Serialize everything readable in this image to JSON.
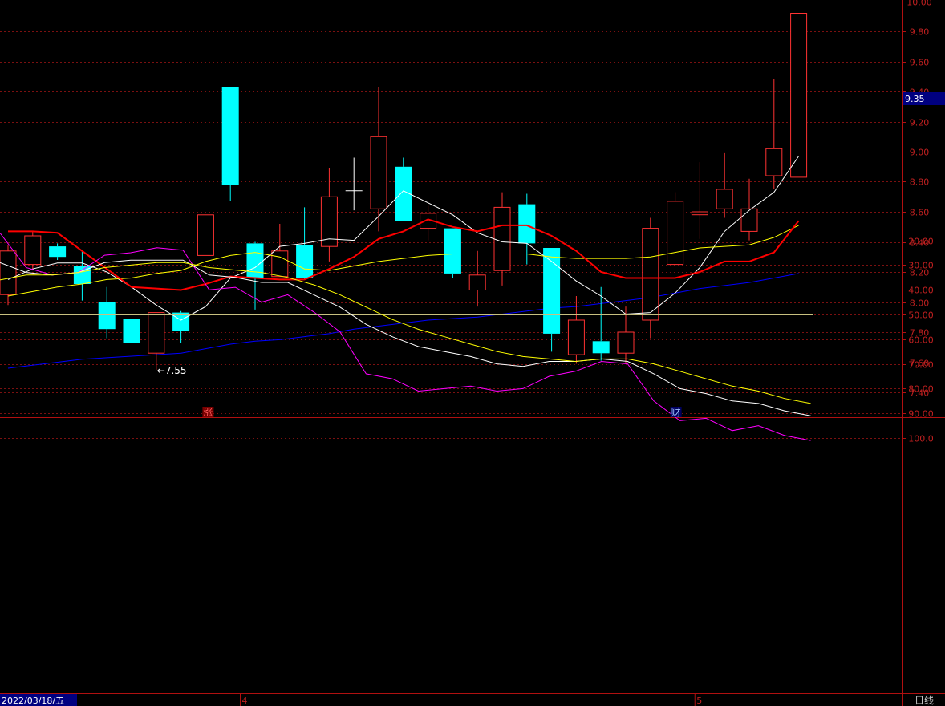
{
  "chart_data": {
    "type": "candlestick",
    "price_axis": {
      "ticks": [
        "10.00",
        "9.80",
        "9.60",
        "9.40",
        "9.20",
        "9.00",
        "8.80",
        "8.60",
        "8.40",
        "8.20",
        "8.00",
        "7.80",
        "7.60",
        "7.40"
      ],
      "ylim": [
        7.23,
        10.03
      ],
      "current_price_label": "9.35"
    },
    "candles": [
      {
        "o": 8.05,
        "h": 8.38,
        "l": 7.98,
        "c": 8.34
      },
      {
        "o": 8.25,
        "h": 8.47,
        "l": 8.21,
        "c": 8.44
      },
      {
        "o": 8.37,
        "h": 8.39,
        "l": 8.28,
        "c": 8.3
      },
      {
        "o": 8.24,
        "h": 8.34,
        "l": 8.01,
        "c": 8.12
      },
      {
        "o": 8.0,
        "h": 8.1,
        "l": 7.76,
        "c": 7.82
      },
      {
        "o": 7.89,
        "h": 7.89,
        "l": 7.73,
        "c": 7.73
      },
      {
        "o": 7.66,
        "h": 7.93,
        "l": 7.55,
        "c": 7.93
      },
      {
        "o": 7.93,
        "h": 7.94,
        "l": 7.73,
        "c": 7.81
      },
      {
        "o": 8.31,
        "h": 8.58,
        "l": 8.31,
        "c": 8.58
      },
      {
        "o": 9.43,
        "h": 9.43,
        "l": 8.67,
        "c": 8.78
      },
      {
        "o": 8.39,
        "h": 8.4,
        "l": 7.95,
        "c": 8.16
      },
      {
        "o": 8.17,
        "h": 8.52,
        "l": 8.17,
        "c": 8.34
      },
      {
        "o": 8.38,
        "h": 8.63,
        "l": 8.15,
        "c": 8.16
      },
      {
        "o": 8.37,
        "h": 8.89,
        "l": 8.27,
        "c": 8.7
      },
      {
        "o": 8.74,
        "h": 8.96,
        "l": 8.61,
        "c": 8.74
      },
      {
        "o": 8.62,
        "h": 9.43,
        "l": 8.47,
        "c": 9.1
      },
      {
        "o": 8.9,
        "h": 8.96,
        "l": 8.54,
        "c": 8.54
      },
      {
        "o": 8.49,
        "h": 8.64,
        "l": 8.41,
        "c": 8.59
      },
      {
        "o": 8.49,
        "h": 8.49,
        "l": 8.16,
        "c": 8.19
      },
      {
        "o": 8.08,
        "h": 8.34,
        "l": 7.97,
        "c": 8.18
      },
      {
        "o": 8.21,
        "h": 8.73,
        "l": 8.11,
        "c": 8.63
      },
      {
        "o": 8.65,
        "h": 8.72,
        "l": 8.25,
        "c": 8.39
      },
      {
        "o": 8.36,
        "h": 8.36,
        "l": 7.67,
        "c": 7.79
      },
      {
        "o": 7.65,
        "h": 8.04,
        "l": 7.59,
        "c": 7.88
      },
      {
        "o": 7.74,
        "h": 8.1,
        "l": 7.61,
        "c": 7.66
      },
      {
        "o": 7.66,
        "h": 7.97,
        "l": 7.59,
        "c": 7.8
      },
      {
        "o": 7.88,
        "h": 8.56,
        "l": 7.76,
        "c": 8.49
      },
      {
        "o": 8.25,
        "h": 8.73,
        "l": 8.25,
        "c": 8.67
      },
      {
        "o": 8.58,
        "h": 8.93,
        "l": 8.42,
        "c": 8.6
      },
      {
        "o": 8.62,
        "h": 8.99,
        "l": 8.56,
        "c": 8.75
      },
      {
        "o": 8.47,
        "h": 8.82,
        "l": 8.41,
        "c": 8.62
      },
      {
        "o": 8.84,
        "h": 9.48,
        "l": 8.75,
        "c": 9.02
      },
      {
        "o": 8.83,
        "h": 9.92,
        "l": 8.83,
        "c": 9.92
      }
    ],
    "ma_lines": [
      {
        "color": "#ffffff",
        "values": [
          8.15,
          8.22,
          8.26,
          8.26,
          8.2,
          8.1,
          7.98,
          7.88,
          7.97,
          8.16,
          8.23,
          8.37,
          8.39,
          8.42,
          8.41,
          8.57,
          8.74,
          8.66,
          8.58,
          8.46,
          8.4,
          8.39,
          8.27,
          8.14,
          8.04,
          7.92,
          7.93,
          8.06,
          8.23,
          8.47,
          8.61,
          8.73,
          8.97
        ]
      },
      {
        "color": "#ffff00",
        "values": [
          8.04,
          8.07,
          8.1,
          8.12,
          8.15,
          8.16,
          8.19,
          8.21,
          8.27,
          8.31,
          8.33,
          8.3,
          8.22,
          8.21,
          8.24,
          8.27,
          8.29,
          8.31,
          8.32,
          8.32,
          8.32,
          8.32,
          8.3,
          8.29,
          8.29,
          8.29,
          8.3,
          8.33,
          8.36,
          8.37,
          8.38,
          8.43,
          8.51
        ]
      },
      {
        "color": "#ff0000",
        "values": [
          8.47,
          8.47,
          8.46,
          8.34,
          8.22,
          8.1,
          8.09,
          8.08,
          8.12,
          8.17,
          8.16,
          8.15,
          8.15,
          8.22,
          8.3,
          8.42,
          8.47,
          8.55,
          8.5,
          8.47,
          8.51,
          8.51,
          8.44,
          8.34,
          8.2,
          8.16,
          8.16,
          8.16,
          8.2,
          8.27,
          8.27,
          8.33,
          8.54
        ]
      },
      {
        "color": "#0000ff",
        "values": [
          7.56,
          7.58,
          7.6,
          7.62,
          7.63,
          7.64,
          7.65,
          7.66,
          7.69,
          7.72,
          7.74,
          7.75,
          7.77,
          7.79,
          7.82,
          7.84,
          7.86,
          7.88,
          7.89,
          7.9,
          7.92,
          7.94,
          7.96,
          7.97,
          7.99,
          8.01,
          8.03,
          8.06,
          8.09,
          8.11,
          8.13,
          8.16,
          8.19
        ]
      }
    ],
    "annotations": [
      {
        "text": "←7.55",
        "index": 6
      },
      {
        "text": "涨",
        "index": 8
      },
      {
        "text": "财",
        "index": 27
      }
    ],
    "indicator": {
      "ticks": [
        "100.0",
        "90.00",
        "80.00",
        "70.00",
        "60.00",
        "50.00",
        "40.00",
        "30.00",
        "20.00"
      ],
      "ylim": [
        8,
        103
      ],
      "reference_line": 50,
      "lines": [
        {
          "color": "#ff00ff",
          "values": [
            17,
            31,
            34,
            33,
            26,
            25,
            23,
            24,
            40,
            39,
            45,
            42,
            49,
            57,
            74,
            76,
            81,
            80,
            79,
            81,
            80,
            75,
            73,
            69,
            70,
            85,
            93,
            92,
            97,
            95,
            99,
            101
          ]
        },
        {
          "color": "#ffffff",
          "values": [
            29,
            33,
            34,
            33,
            29,
            28,
            28,
            28,
            34,
            35,
            37,
            37,
            42,
            47,
            54,
            59,
            63,
            65,
            67,
            70,
            71,
            69,
            69,
            68,
            69,
            74,
            80,
            82,
            85,
            86,
            89,
            91
          ]
        },
        {
          "color": "#ffff00",
          "values": [
            36,
            34,
            34,
            33,
            31,
            30,
            29,
            29,
            31,
            32,
            33,
            35,
            38,
            42,
            47,
            52,
            56,
            59,
            62,
            65,
            67,
            68,
            69,
            68,
            68,
            70,
            73,
            76,
            79,
            81,
            84,
            86
          ]
        }
      ]
    },
    "x_axis": {
      "labels": [
        {
          "text": "2022/03/18/五",
          "index": 0
        },
        {
          "text": "4",
          "index": 9.4
        },
        {
          "text": "5",
          "index": 27.8
        }
      ],
      "period_label": "日线"
    }
  }
}
